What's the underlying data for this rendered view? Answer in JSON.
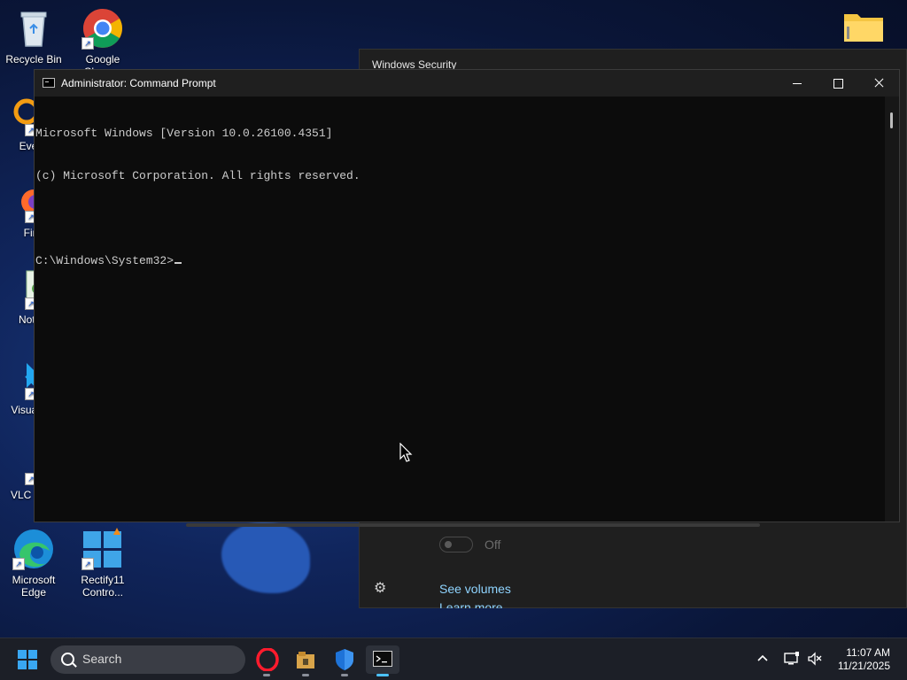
{
  "desktop": {
    "icons": [
      {
        "label": "Recycle Bin"
      },
      {
        "label": "Google Chrome"
      },
      {
        "label": "Every"
      },
      {
        "label": "Fire"
      },
      {
        "label": "Notep"
      },
      {
        "label": "Visual Co"
      },
      {
        "label": "VLC r play"
      },
      {
        "label": "Microsoft Edge"
      },
      {
        "label": "Rectify11 Contro..."
      }
    ]
  },
  "security_window": {
    "title": "Windows Security",
    "toggle_state_label": "Off",
    "links": [
      "See volumes",
      "Learn more"
    ]
  },
  "cmd_window": {
    "title": "Administrator: Command Prompt",
    "lines": [
      "Microsoft Windows [Version 10.0.26100.4351]",
      "(c) Microsoft Corporation. All rights reserved.",
      "",
      "C:\\Windows\\System32>"
    ]
  },
  "taskbar": {
    "search_label": "Search",
    "apps": [
      "opera-icon",
      "file-explorer-icon",
      "windows-security-icon",
      "terminal-icon"
    ],
    "clock": {
      "time": "11:07 AM",
      "date": "11/21/2025"
    }
  },
  "colors": {
    "console_bg": "#0c0c0c",
    "console_text": "#cccccc",
    "titlebar": "#1f1f1f",
    "accent": "#4cc2ff",
    "link": "#8fd4ff"
  }
}
